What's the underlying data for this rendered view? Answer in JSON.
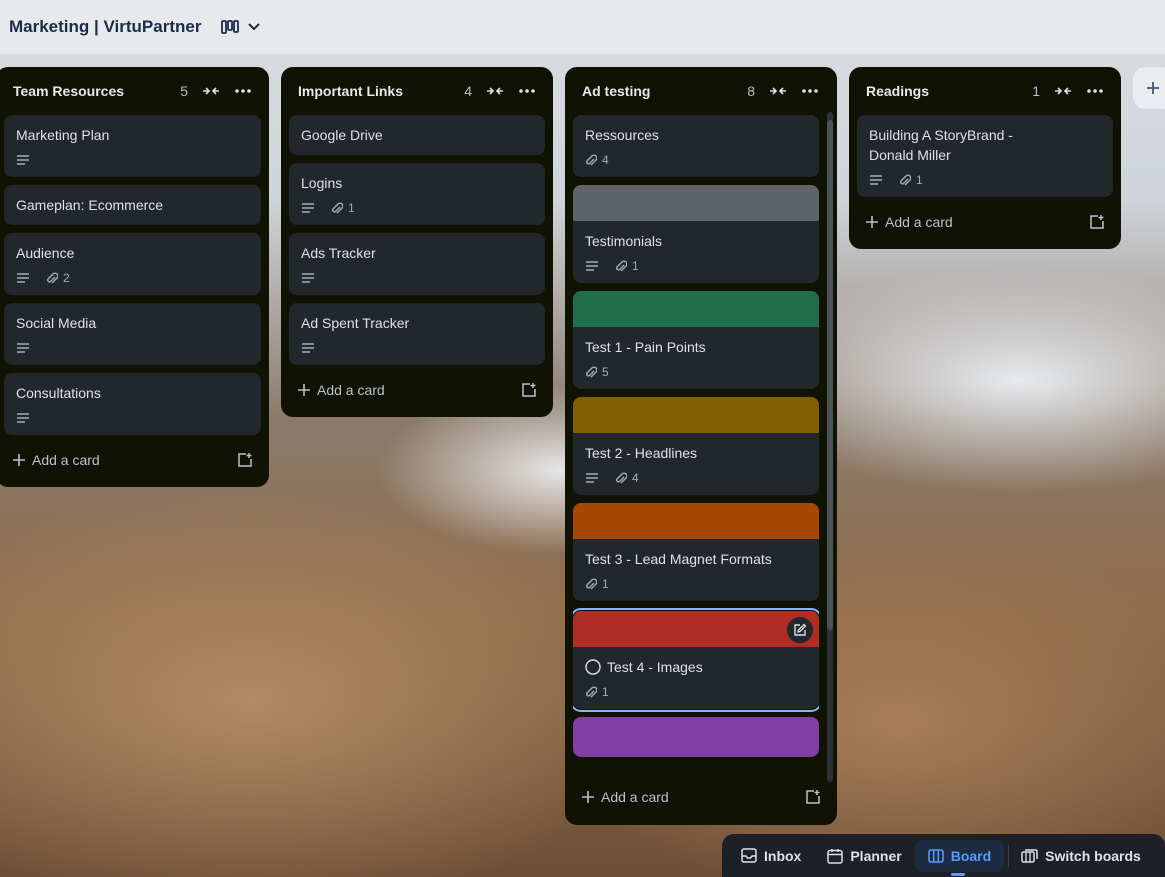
{
  "header": {
    "board_title": "Marketing | VirtuPartner"
  },
  "lists": [
    {
      "title": "Team Resources",
      "count": "5",
      "cards": [
        {
          "title": "Marketing Plan",
          "desc": true
        },
        {
          "title": "Gameplan: Ecommerce"
        },
        {
          "title": "Audience",
          "desc": true,
          "attachments": "2"
        },
        {
          "title": "Social Media",
          "desc": true
        },
        {
          "title": "Consultations",
          "desc": true
        }
      ]
    },
    {
      "title": "Important Links",
      "count": "4",
      "cards": [
        {
          "title": "Google Drive"
        },
        {
          "title": "Logins",
          "desc": true,
          "attachments": "1"
        },
        {
          "title": "Ads Tracker",
          "desc": true
        },
        {
          "title": "Ad Spent Tracker",
          "desc": true
        }
      ]
    },
    {
      "title": "Ad testing",
      "count": "8",
      "cards": [
        {
          "title": "Ressources",
          "attachments": "4"
        },
        {
          "title": "Testimonials",
          "cover": "#5f6469",
          "desc": true,
          "attachments": "1"
        },
        {
          "title": "Test 1 - Pain Points",
          "cover": "#216e4e",
          "attachments": "5"
        },
        {
          "title": "Test 2 - Headlines",
          "cover": "#7f5f01",
          "desc": true,
          "attachments": "4"
        },
        {
          "title": "Test 3 - Lead Magnet Formats",
          "cover": "#a54800",
          "attachments": "1"
        },
        {
          "title": "Test 4 - Images",
          "cover": "#ae2e24",
          "attachments": "1"
        },
        {
          "title": "",
          "cover": "#803fa5"
        }
      ]
    },
    {
      "title": "Readings",
      "count": "1",
      "cards": [
        {
          "title": "Building A StoryBrand - Donald Miller",
          "desc": true,
          "attachments": "1"
        }
      ]
    }
  ],
  "add_card_label": "Add a card",
  "bottom_nav": {
    "inbox": "Inbox",
    "planner": "Planner",
    "board": "Board",
    "switch": "Switch boards"
  },
  "colors": {
    "list_bg": "#101204",
    "card_bg": "#22272b",
    "active_accent": "#579dff"
  }
}
